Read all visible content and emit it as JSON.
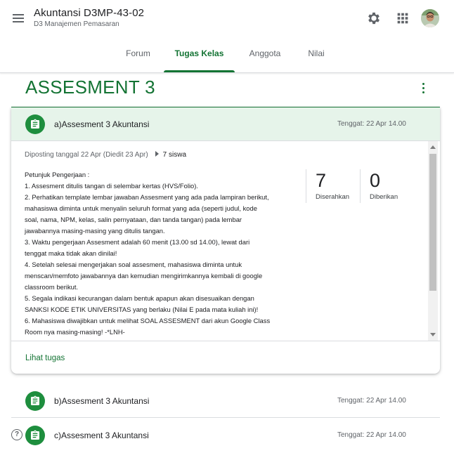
{
  "header": {
    "course_title": "Akuntansi D3MP-43-02",
    "course_subtitle": "D3 Manajemen Pemasaran",
    "tabs": [
      "Forum",
      "Tugas Kelas",
      "Anggota",
      "Nilai"
    ],
    "active_tab": "Tugas Kelas",
    "icons": [
      "menu-icon",
      "gear-icon",
      "apps-grid-icon",
      "avatar"
    ]
  },
  "topic": {
    "title": "ASSESMENT 3"
  },
  "colors": {
    "accent": "#137333",
    "accent_light": "#e6f4ea",
    "icon_green": "#1e8e3e"
  },
  "expanded": {
    "title": "a)Assesment 3 Akuntansi",
    "due": "Tenggat: 22 Apr 14.00",
    "posted": "Diposting tanggal 22 Apr (Diedit 23 Apr)",
    "students": "7 siswa",
    "instructions": [
      "Petunjuk Pengerjaan :",
      "1. Assesment ditulis tangan di selembar kertas (HVS/Folio).",
      "2. Perhatikan template lembar jawaban Assesment yang ada pada lampiran berikut,",
      "mahasiswa diminta untuk menyalin seluruh format yang ada (seperti judul, kode",
      "soal, nama, NPM, kelas, salin pernyataan, dan tanda tangan) pada lembar",
      "jawabannya masing-masing yang ditulis tangan.",
      "3. Waktu pengerjaan Assesment adalah 60 menit (13.00 sd 14.00), lewat dari",
      "tenggat maka tidak akan dinilai!",
      "4. Setelah selesai mengerjakan soal assesment, mahasiswa diminta untuk",
      "menscan/memfoto jawabannya dan kemudian mengirimkannya kembali di google",
      "classroom berikut.",
      "5. Segala indikasi kecurangan dalam bentuk apapun akan disesuaikan dengan",
      "SANKSI KODE ETIK UNIVERSITAS yang berlaku (Nilai E pada mata kuliah ini)!",
      "6. Mahasiswa diwajibkan untuk melihat SOAL ASSESMENT dari akun Google Class",
      "Room nya masing-masing! -*LNH-"
    ],
    "submitted_count": "7",
    "submitted_label": "Diserahkan",
    "assigned_count": "0",
    "assigned_label": "Diberikan",
    "view_link": "Lihat tugas"
  },
  "items": [
    {
      "title": "b)Assesment 3 Akuntansi",
      "due": "Tenggat: 22 Apr 14.00"
    },
    {
      "title": "c)Assesment 3 Akuntansi",
      "due": "Tenggat: 22 Apr 14.00"
    }
  ]
}
